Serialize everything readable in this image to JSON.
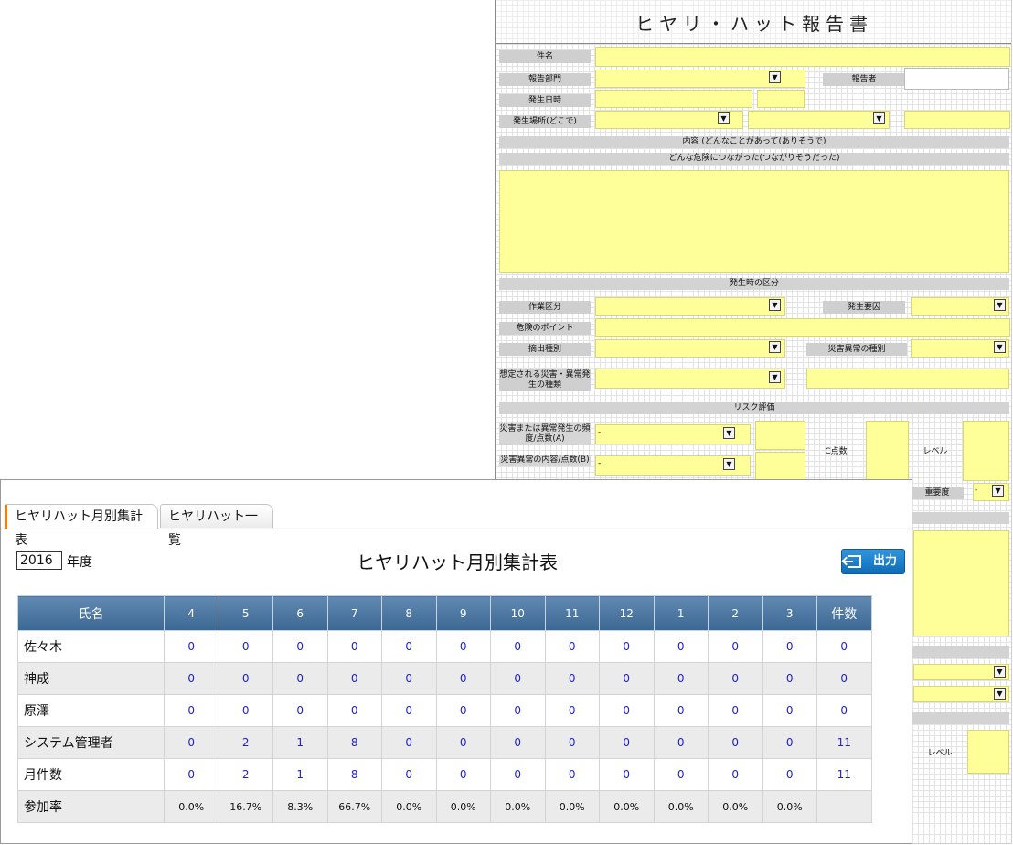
{
  "report_form": {
    "title": "ヒヤリ・ハット報告書",
    "labels": {
      "subject": "件名",
      "department": "報告部門",
      "reporter": "報告者",
      "datetime": "発生日時",
      "location": "発生場所(どこで)",
      "content_1": "内容 (どんなことがあって(ありそうで)",
      "content_2": "どんな危険につながった(つながりそうだった)",
      "classification": "発生時の区分",
      "work_type": "作業区分",
      "cause": "発生要因",
      "danger_point": "危険のポイント",
      "extraction_type": "摘出種別",
      "disaster_type": "災害異常の種別",
      "assumed_disaster": "想定される災害・異常発生の種類",
      "risk_eval": "リスク評価",
      "frequency": "災害または異常発生の頻度/点数(A)",
      "severity": "災害異常の内容/点数(B)",
      "c_score": "C点数",
      "level": "レベル",
      "importance": "重要度",
      "level_2": "レベル"
    },
    "dropdown_dash": "-"
  },
  "summary": {
    "tabs": [
      {
        "label": "ヒヤリハット月別集計表"
      },
      {
        "label": "ヒヤリハット一覧"
      }
    ],
    "year": "2016",
    "year_suffix": "年度",
    "title": "ヒヤリハット月別集計表",
    "export_label": "出力",
    "table": {
      "headers": [
        "氏名",
        "4",
        "5",
        "6",
        "7",
        "8",
        "9",
        "10",
        "11",
        "12",
        "1",
        "2",
        "3",
        "件数"
      ],
      "rows": [
        {
          "name": "佐々木",
          "cells": [
            "0",
            "0",
            "0",
            "0",
            "0",
            "0",
            "0",
            "0",
            "0",
            "0",
            "0",
            "0",
            "0"
          ]
        },
        {
          "name": "神成",
          "cells": [
            "0",
            "0",
            "0",
            "0",
            "0",
            "0",
            "0",
            "0",
            "0",
            "0",
            "0",
            "0",
            "0"
          ]
        },
        {
          "name": "原澤",
          "cells": [
            "0",
            "0",
            "0",
            "0",
            "0",
            "0",
            "0",
            "0",
            "0",
            "0",
            "0",
            "0",
            "0"
          ]
        },
        {
          "name": "システム管理者",
          "cells": [
            "0",
            "2",
            "1",
            "8",
            "0",
            "0",
            "0",
            "0",
            "0",
            "0",
            "0",
            "0",
            "11"
          ]
        },
        {
          "name": "月件数",
          "cells": [
            "0",
            "2",
            "1",
            "8",
            "0",
            "0",
            "0",
            "0",
            "0",
            "0",
            "0",
            "0",
            "11"
          ]
        },
        {
          "name": "参加率",
          "cells": [
            "0.0%",
            "16.7%",
            "8.3%",
            "66.7%",
            "0.0%",
            "0.0%",
            "0.0%",
            "0.0%",
            "0.0%",
            "0.0%",
            "0.0%",
            "0.0%",
            ""
          ]
        }
      ]
    }
  }
}
